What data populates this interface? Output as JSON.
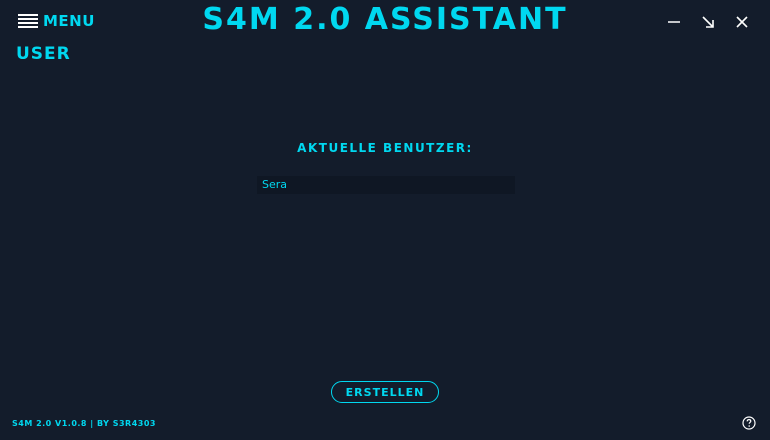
{
  "header": {
    "menu_label": "MENU",
    "app_title": "S4M 2.0 ASSISTANT",
    "window_controls": [
      "minimize-icon",
      "restore-icon",
      "close-icon"
    ]
  },
  "page": {
    "title": "USER"
  },
  "users_section": {
    "label": "AKTUELLE BENUTZER:",
    "users": [
      "Sera"
    ]
  },
  "actions": {
    "create_label": "ERSTELLEN"
  },
  "footer": {
    "version_text": "S4M 2.0 V1.0.8 | BY S3R4303"
  },
  "icons": {
    "menu": "hamburger-icon",
    "help": "help-icon"
  },
  "colors": {
    "background": "#131c2b",
    "accent": "#00d8f0",
    "list_background": "#0f1724"
  }
}
